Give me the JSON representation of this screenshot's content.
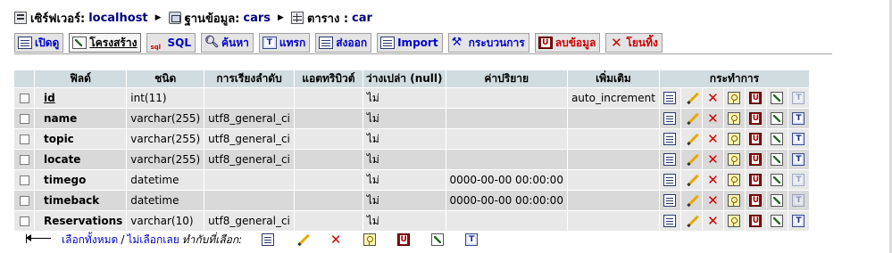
{
  "breadcrumb": {
    "server_label": "เซิร์ฟเวอร์: ",
    "server": "localhost",
    "db_label": "ฐานข้อมูล: ",
    "db": "cars",
    "table_label": "ตาราง : ",
    "table": "car"
  },
  "tabs": [
    {
      "label": "เปิดดู",
      "icon": "browse-icon"
    },
    {
      "label": "โครงสร้าง",
      "icon": "structure-icon"
    },
    {
      "label": "SQL",
      "icon": "sql-icon"
    },
    {
      "label": "ค้นหา",
      "icon": "search-icon"
    },
    {
      "label": "แทรก",
      "icon": "insert-icon"
    },
    {
      "label": "ส่งออก",
      "icon": "export-icon"
    },
    {
      "label": "Import",
      "icon": "import-icon"
    },
    {
      "label": "กระบวนการ",
      "icon": "operations-icon"
    },
    {
      "label": "ลบข้อมูล",
      "icon": "empty-icon"
    },
    {
      "label": "โยนทิ้ง",
      "icon": "drop-icon"
    }
  ],
  "table": {
    "headers": {
      "field": "ฟิลด์",
      "type": "ชนิด",
      "collation": "การเรียงลำดับ",
      "attributes": "แอตทริบิวต์",
      "null": "ว่างเปล่า (null)",
      "default": "ค่าปริยาย",
      "extra": "เพิ่มเติม",
      "action": "กระทำการ"
    },
    "rows": [
      {
        "name": "id",
        "type": "int(11)",
        "collation": "",
        "attributes": "",
        "null": "ไม่",
        "default": "",
        "extra": "auto_increment"
      },
      {
        "name": "name",
        "type": "varchar(255)",
        "collation": "utf8_general_ci",
        "attributes": "",
        "null": "ไม่",
        "default": "",
        "extra": ""
      },
      {
        "name": "topic",
        "type": "varchar(255)",
        "collation": "utf8_general_ci",
        "attributes": "",
        "null": "ไม่",
        "default": "",
        "extra": ""
      },
      {
        "name": "locate",
        "type": "varchar(255)",
        "collation": "utf8_general_ci",
        "attributes": "",
        "null": "ไม่",
        "default": "",
        "extra": ""
      },
      {
        "name": "timego",
        "type": "datetime",
        "collation": "",
        "attributes": "",
        "null": "ไม่",
        "default": "0000-00-00 00:00:00",
        "extra": ""
      },
      {
        "name": "timeback",
        "type": "datetime",
        "collation": "",
        "attributes": "",
        "null": "ไม่",
        "default": "0000-00-00 00:00:00",
        "extra": ""
      },
      {
        "name": "Reservations",
        "type": "varchar(10)",
        "collation": "utf8_general_ci",
        "attributes": "",
        "null": "ไม่",
        "default": "",
        "extra": ""
      }
    ]
  },
  "footer": {
    "check_all": "เลือกทั้งหมด",
    "separator": "/",
    "uncheck_all": "ไม่เลือกเลย",
    "with_selected": "ทำกับที่เลือก:"
  }
}
